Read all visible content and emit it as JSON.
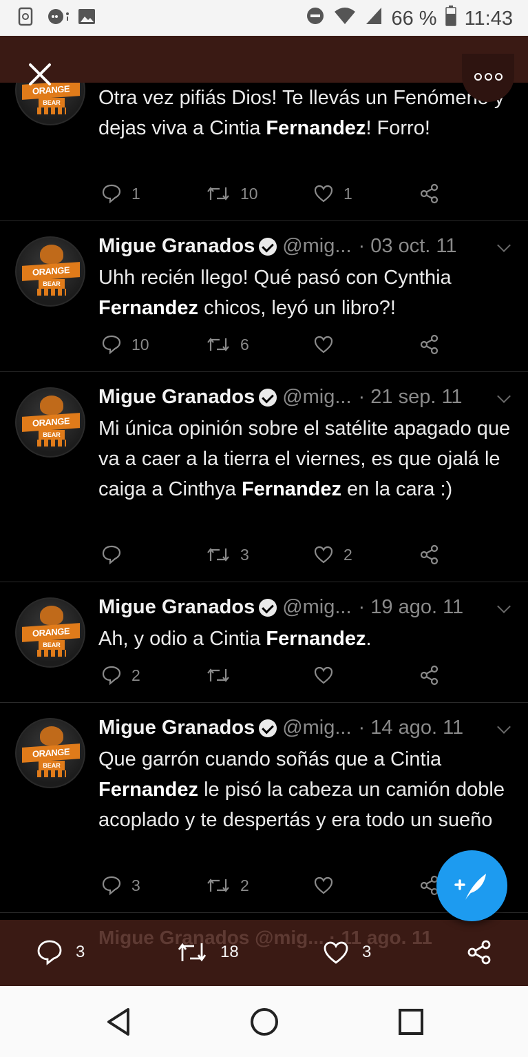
{
  "status_bar": {
    "battery": "66 %",
    "time": "11:43",
    "icons": [
      "screenshot-icon",
      "chat-icon",
      "image-icon",
      "do-not-disturb-icon",
      "wifi-icon",
      "signal-icon",
      "battery-icon"
    ]
  },
  "top_bar": {
    "close_icon": "close-icon",
    "more_icon": "more-options-icon"
  },
  "tweets": [
    {
      "name": "",
      "handle": "",
      "date": "",
      "text_parts": [
        "Otra vez pifiás Dios! Te llevás un Fenómeno y dejas viva a Cintia ",
        "Fernandez",
        "! Forro!"
      ],
      "replies": "1",
      "retweets": "10",
      "likes": "1"
    },
    {
      "name": "Migue Granados",
      "handle": "@mig...",
      "date": "· 03 oct. 11",
      "text_parts": [
        "Uhh recién llego! Qué pasó con Cynthia ",
        "Fernandez",
        " chicos, leyó un libro?!"
      ],
      "replies": "10",
      "retweets": "6",
      "likes": ""
    },
    {
      "name": "Migue Granados",
      "handle": "@mig...",
      "date": "· 21 sep. 11",
      "text_parts": [
        "Mi única opinión sobre el satélite apagado que va a caer a la tierra el viernes, es que ojalá le caiga a Cinthya ",
        "Fernandez",
        " en la cara :)"
      ],
      "replies": "",
      "retweets": "3",
      "likes": "2"
    },
    {
      "name": "Migue Granados",
      "handle": "@mig...",
      "date": "· 19 ago. 11",
      "text_parts": [
        "Ah, y odio a Cintia ",
        "Fernandez",
        "."
      ],
      "replies": "2",
      "retweets": "",
      "likes": ""
    },
    {
      "name": "Migue Granados",
      "handle": "@mig...",
      "date": "· 14 ago. 11",
      "text_parts": [
        "Que garrón cuando soñás que a Cintia ",
        "Fernandez",
        " le pisó la cabeza un camión doble acoplado y te despertás y era todo un sueño"
      ],
      "replies": "3",
      "retweets": "2",
      "likes": ""
    }
  ],
  "avatar_text": {
    "top": "ORANGE",
    "bottom": "BEAR"
  },
  "partial_next": "Migue Granados @mig... · 11 ago. 11",
  "stats_bar": {
    "replies": "3",
    "retweets": "18",
    "likes": "3"
  },
  "fab": {
    "icon": "compose-tweet-icon"
  },
  "colors": {
    "background": "#000000",
    "bar": "#3a1a14",
    "accent": "#1d9bf0",
    "muted": "#8a8a8a"
  }
}
